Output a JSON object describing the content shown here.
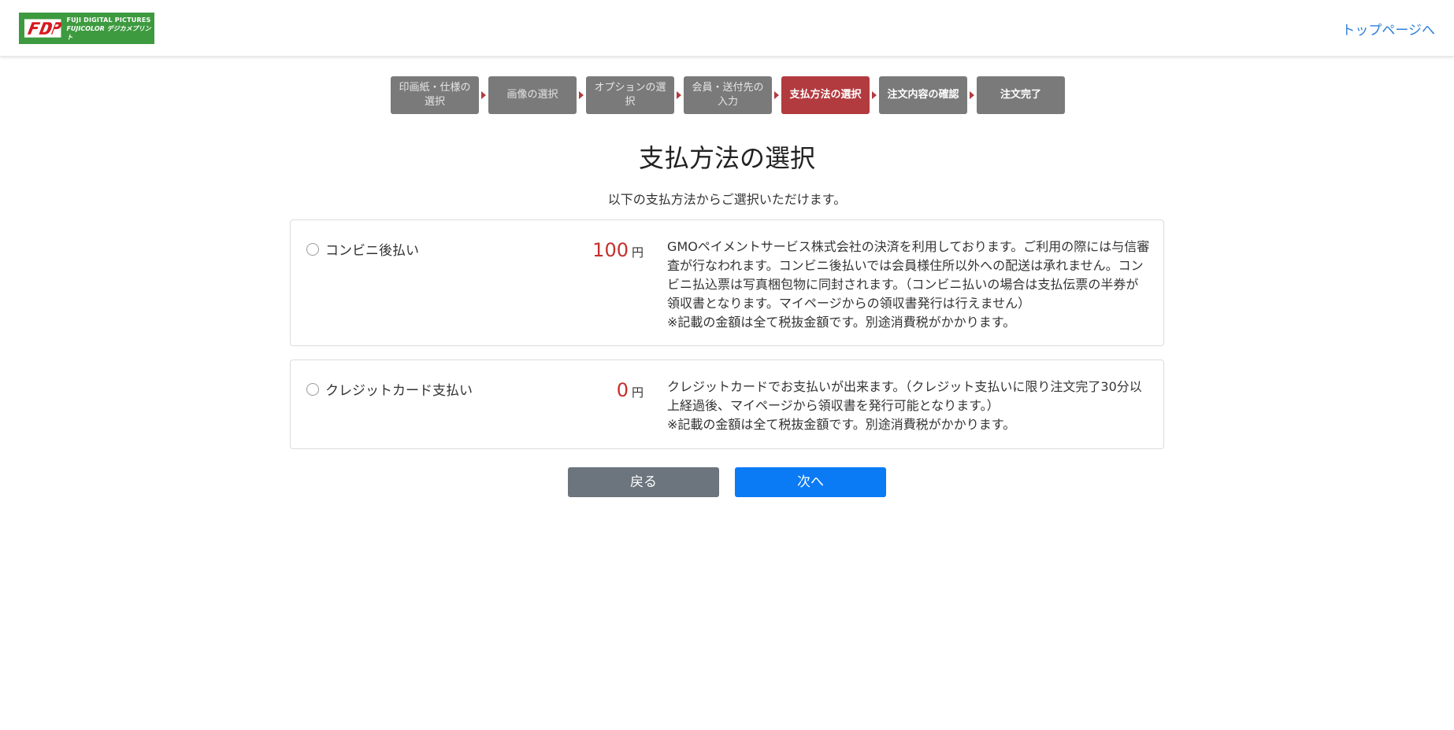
{
  "header": {
    "logo": {
      "line1": "FUJI DIGITAL PICTURES",
      "line2": "FUJICOLOR デジカメプリント"
    },
    "top_link": "トップページへ"
  },
  "steps": [
    {
      "label": "印画紙・仕様の選択",
      "state": "done"
    },
    {
      "label": "画像の選択",
      "state": "done"
    },
    {
      "label": "オプションの選択",
      "state": "done"
    },
    {
      "label": "会員・送付先の入力",
      "state": "done"
    },
    {
      "label": "支払方法の選択",
      "state": "active"
    },
    {
      "label": "注文内容の確認",
      "state": "next"
    },
    {
      "label": "注文完了",
      "state": "next"
    }
  ],
  "main": {
    "title": "支払方法の選択",
    "subtitle": "以下の支払方法からご選択いただけます。"
  },
  "methods": [
    {
      "label": "コンビニ後払い",
      "price": "100",
      "unit": "円",
      "description": "GMOペイメントサービス株式会社の決済を利用しております。ご利用の際には与信審査が行なわれます。コンビニ後払いでは会員様住所以外への配送は承れません。コンビニ払込票は写真梱包物に同封されます。（コンビニ払いの場合は支払伝票の半券が領収書となります。マイページからの領収書発行は行えません）",
      "note": "※記載の金額は全て税抜金額です。別途消費税がかかります。",
      "selected": false
    },
    {
      "label": "クレジットカード支払い",
      "price": "0",
      "unit": "円",
      "description": "クレジットカードでお支払いが出来ます。（クレジット支払いに限り注文完了30分以上経過後、マイページから領収書を発行可能となります。）",
      "note": "※記載の金額は全て税抜金額です。別途消費税がかかります。",
      "selected": false
    }
  ],
  "buttons": {
    "back": "戻る",
    "next": "次へ"
  },
  "colors": {
    "active_step": "#b23b3f",
    "step": "#7a7a7a",
    "price": "#c4302b",
    "next_button": "#0a7bf5",
    "back_button": "#6c757d",
    "link": "#2f7fd8",
    "logo_bg": "#3d9a3f"
  }
}
